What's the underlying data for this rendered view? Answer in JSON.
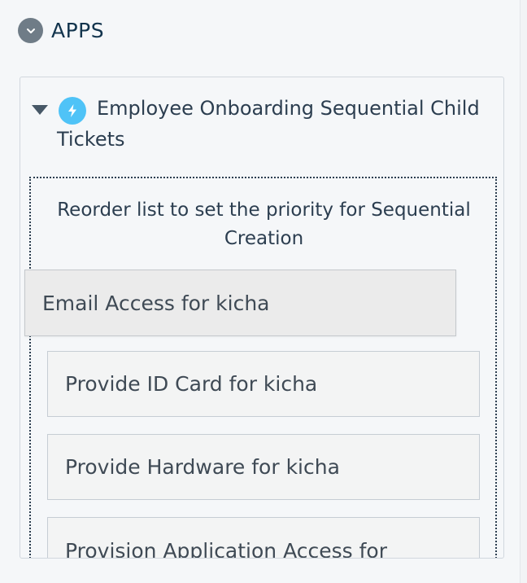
{
  "sidebar": {
    "section_title": "APPS"
  },
  "app": {
    "title": "Employee Onboarding Sequential Child Tickets",
    "reorder_hint": "Reorder list to set the priority for Sequential Creation",
    "tickets": [
      {
        "label": "Email Access for kicha",
        "state": "dragging"
      },
      {
        "label": "Provide ID Card for kicha"
      },
      {
        "label": "Provide Hardware for kicha"
      },
      {
        "label": "Provision Application Access for"
      }
    ]
  },
  "colors": {
    "accent": "#4fc3f7",
    "toggle": "#6f7c87",
    "text": "#2c3e50"
  },
  "icons": {
    "section_toggle": "chevron-down-icon",
    "app_expand": "caret-down-icon",
    "app_logo": "lightning-bolt-icon"
  }
}
